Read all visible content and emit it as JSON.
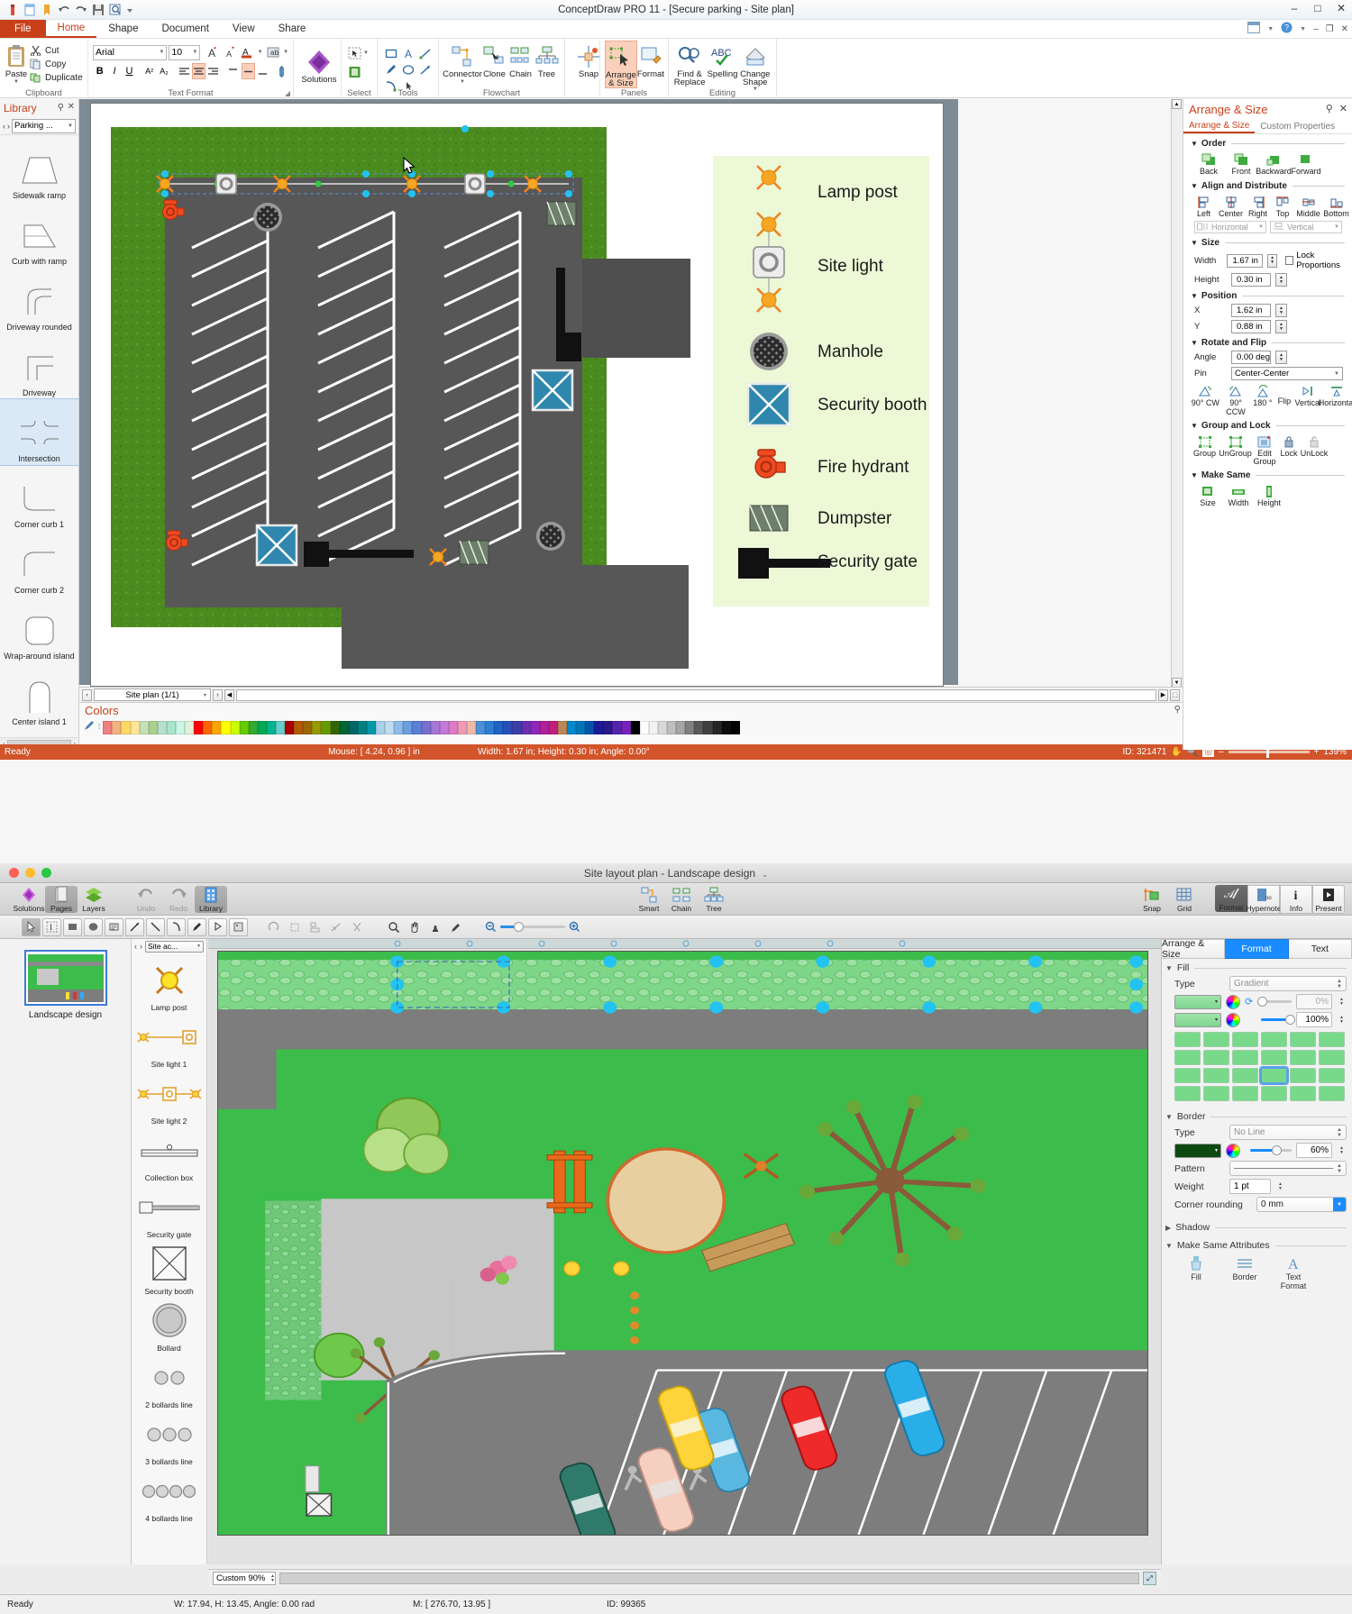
{
  "win1": {
    "title": "ConceptDraw PRO 11 - [Secure parking - Site plan]",
    "window_buttons": [
      "–",
      "□",
      "✕"
    ],
    "quick_access": [
      "new-icon",
      "open-icon",
      "doc-icon",
      "undo-icon",
      "redo-icon",
      "save-icon",
      "print-preview-icon",
      "qat-dropdown-icon"
    ],
    "tabs": [
      {
        "label": "File",
        "kind": "file"
      },
      {
        "label": "Home",
        "kind": "active"
      },
      {
        "label": "Shape",
        "kind": "normal"
      },
      {
        "label": "Document",
        "kind": "normal"
      },
      {
        "label": "View",
        "kind": "normal"
      },
      {
        "label": "Share",
        "kind": "normal"
      }
    ],
    "ribbon": {
      "clipboard": {
        "group": "Clipboard",
        "paste": "Paste",
        "cut": "Cut",
        "copy": "Copy",
        "duplicate": "Duplicate"
      },
      "text_format": {
        "group": "Text Format",
        "font_family": "Arial",
        "font_size": "10",
        "buttons": [
          "B",
          "I",
          "U",
          "A²",
          "A₂"
        ]
      },
      "solutions": {
        "group": "",
        "label": "Solutions"
      },
      "select": {
        "group": "Select"
      },
      "tools": {
        "group": "Tools"
      },
      "flowchart": {
        "group": "Flowchart",
        "connector": "Connector",
        "clone": "Clone",
        "chain": "Chain",
        "tree": "Tree",
        "snap": "Snap"
      },
      "panels": {
        "group": "Panels",
        "arrange": "Arrange\n& Size",
        "arrange_l1": "Arrange",
        "arrange_l2": "& Size",
        "format": "Format"
      },
      "editing": {
        "group": "Editing",
        "find": "Find &",
        "find2": "Replace",
        "spelling": "Spelling",
        "change": "Change",
        "change2": "Shape"
      }
    },
    "library": {
      "title": "Library",
      "selector": "Parking ...",
      "items": [
        {
          "label": "Sidewalk ramp",
          "icon": "sidewalk-ramp-shape"
        },
        {
          "label": "Curb with ramp",
          "icon": "curb-with-ramp-shape"
        },
        {
          "label": "Driveway rounded",
          "icon": "driveway-rounded-shape"
        },
        {
          "label": "Driveway",
          "icon": "driveway-shape"
        },
        {
          "label": "Intersection",
          "icon": "intersection-shape",
          "selected": true
        },
        {
          "label": "Corner curb 1",
          "icon": "corner-curb-1-shape"
        },
        {
          "label": "Corner curb 2",
          "icon": "corner-curb-2-shape"
        },
        {
          "label": "Wrap-around island",
          "icon": "wrap-around-island-shape"
        },
        {
          "label": "Center island 1",
          "icon": "center-island-1-shape"
        }
      ]
    },
    "legend": [
      {
        "label": "Lamp post",
        "icon": "lamp-post-icon"
      },
      {
        "label": "Site light",
        "icon": "site-light-icon"
      },
      {
        "label": "Manhole",
        "icon": "manhole-icon"
      },
      {
        "label": "Security booth",
        "icon": "security-booth-icon"
      },
      {
        "label": "Fire hydrant",
        "icon": "fire-hydrant-icon"
      },
      {
        "label": "Dumpster",
        "icon": "dumpster-icon"
      },
      {
        "label": "Security gate",
        "icon": "security-gate-icon"
      }
    ],
    "panel": {
      "title": "Arrange & Size",
      "tabs": [
        {
          "label": "Arrange & Size",
          "active": true
        },
        {
          "label": "Custom Properties",
          "active": false
        }
      ],
      "order": {
        "header": "Order",
        "items": [
          "Back",
          "Front",
          "Backward",
          "Forward"
        ]
      },
      "align": {
        "header": "Align and Distribute",
        "items": [
          "Left",
          "Center",
          "Right",
          "Top",
          "Middle",
          "Bottom"
        ],
        "horizontal": "Horizontal",
        "vertical": "Vertical"
      },
      "size": {
        "header": "Size",
        "width_label": "Width",
        "width": "1.67 in",
        "height_label": "Height",
        "height": "0.30 in",
        "lock": "Lock Proportions"
      },
      "position": {
        "header": "Position",
        "x_label": "X",
        "x": "1.62 in",
        "y_label": "Y",
        "y": "0.88 in"
      },
      "rotate": {
        "header": "Rotate and Flip",
        "angle_label": "Angle",
        "angle": "0.00 deg",
        "pin_label": "Pin",
        "pin": "Center-Center",
        "items": [
          "90° CW",
          "90° CCW",
          "180 °"
        ],
        "flip": "Flip",
        "vertical": "Vertical",
        "horizontal": "Horizontal"
      },
      "group": {
        "header": "Group and Lock",
        "items": [
          "Group",
          "UnGroup",
          "Edit Group",
          "Lock",
          "UnLock"
        ]
      },
      "makesame": {
        "header": "Make Same",
        "items": [
          "Size",
          "Width",
          "Height"
        ]
      }
    },
    "pagebar": {
      "tab": "Site plan (1/1)"
    },
    "colors": {
      "title": "Colors"
    },
    "status": {
      "ready": "Ready",
      "mouse": "Mouse: [ 4.24, 0.96 ] in",
      "dims": "Width: 1.67 in;  Height: 0.30 in;  Angle: 0.00°",
      "id": "ID: 321471",
      "zoom": "139%"
    }
  },
  "win2": {
    "title": "Site layout plan - Landscape design",
    "toolbar": {
      "left": [
        {
          "label": "Solutions",
          "icon": "solutions-icon"
        },
        {
          "label": "Pages",
          "icon": "pages-icon",
          "active": true
        },
        {
          "label": "Layers",
          "icon": "layers-icon"
        }
      ],
      "history": [
        {
          "label": "Undo",
          "icon": "undo-icon",
          "disabled": true
        },
        {
          "label": "Redo",
          "icon": "redo-icon",
          "disabled": true
        },
        {
          "label": "Library",
          "icon": "library-icon",
          "active": true
        }
      ],
      "center": [
        {
          "label": "Smart",
          "icon": "smart-connector-icon"
        },
        {
          "label": "Chain",
          "icon": "chain-icon"
        },
        {
          "label": "Tree",
          "icon": "tree-icon"
        }
      ],
      "snapgrid": [
        {
          "label": "Snap",
          "icon": "snap-icon"
        },
        {
          "label": "Grid",
          "icon": "grid-icon"
        }
      ],
      "right": [
        {
          "label": "Format",
          "icon": "format-icon",
          "active": true
        },
        {
          "label": "Hypernote",
          "icon": "hypernote-icon"
        },
        {
          "label": "Info",
          "icon": "info-icon"
        },
        {
          "label": "Present",
          "icon": "present-icon"
        }
      ]
    },
    "thumbnail": {
      "label": "Landscape design"
    },
    "library": {
      "selector": "Site ac...",
      "items": [
        {
          "label": "Lamp post",
          "icon": "lamp-post-icon"
        },
        {
          "label": "Site light 1",
          "icon": "site-light-1-icon"
        },
        {
          "label": "Site light 2",
          "icon": "site-light-2-icon"
        },
        {
          "label": "Collection box",
          "icon": "collection-box-icon"
        },
        {
          "label": "Security gate",
          "icon": "security-gate-icon"
        },
        {
          "label": "Security booth",
          "icon": "security-booth-icon"
        },
        {
          "label": "Bollard",
          "icon": "bollard-icon"
        },
        {
          "label": "2 bollards line",
          "icon": "2-bollards-line-icon"
        },
        {
          "label": "3 bollards line",
          "icon": "3-bollards-line-icon"
        },
        {
          "label": "4 bollards line",
          "icon": "4-bollards-line-icon"
        }
      ]
    },
    "panel": {
      "tabs": [
        {
          "label": "Arrange & Size",
          "active": false
        },
        {
          "label": "Format",
          "active": true
        },
        {
          "label": "Text",
          "active": false
        }
      ],
      "fill": {
        "header": "Fill",
        "type_label": "Type",
        "type": "Gradient",
        "stop1_pct": "0%",
        "stop2_pct": "100%",
        "color1": "#8fdd9b",
        "color2": "#8fdd9b",
        "swatch_rows": 4,
        "swatch_cols": 6,
        "selected_index": 15
      },
      "border": {
        "header": "Border",
        "type_label": "Type",
        "type": "No Line",
        "color": "#0d4a12",
        "opacity": "60%",
        "pattern_label": "Pattern",
        "weight_label": "Weight",
        "weight": "1 pt",
        "corner_label": "Corner rounding",
        "corner": "0 mm"
      },
      "shadow": {
        "header": "Shadow"
      },
      "makesame": {
        "header": "Make Same Attributes",
        "items": [
          "Fill",
          "Border",
          "Text Format"
        ]
      }
    },
    "bottombar": {
      "zoom": "Custom 90%"
    },
    "status": {
      "ready": "Ready",
      "dims": "W: 17.94,  H: 13.45,  Angle: 0.00 rad",
      "mouse": "M: [ 276.70, 13.95 ]",
      "id": "ID: 99365"
    }
  },
  "palette": {
    "accent_red": "#c8401a",
    "status_bar": "#d1542a",
    "mac_blue": "#1a8cff",
    "grass": "#4a8a1f",
    "asphalt": "#575757",
    "legend_bg": "#ecf8d6",
    "booth_blue": "#2f87ad",
    "lamp_orange": "#f5a623",
    "hydrant_red": "#e8491f",
    "w2_grass": "#3cbc4a",
    "w2_road": "#7d7d7d"
  },
  "color_swatches": [
    "#f08080",
    "#f4b183",
    "#ffd966",
    "#ffe699",
    "#c6e0b4",
    "#a9d08e",
    "#b7e1cd",
    "#a8e6cf",
    "#c9f7e5",
    "#e2f0d9",
    "#ff0000",
    "#ff6600",
    "#ffa500",
    "#ffff00",
    "#ccff00",
    "#66cc00",
    "#33aa33",
    "#00aa55",
    "#00b38f",
    "#66cccc",
    "#aa0000",
    "#b35900",
    "#996600",
    "#999900",
    "#669900",
    "#336600",
    "#006633",
    "#006666",
    "#008080",
    "#0099aa",
    "#a8d0e8",
    "#c0dcf0",
    "#8fbbe8",
    "#6a9fe0",
    "#5b7fd4",
    "#7a6fd0",
    "#a678d6",
    "#c27ad8",
    "#e07ac4",
    "#f09ab8",
    "#f0b8a8",
    "#4a90d9",
    "#2e7fd4",
    "#1f63c4",
    "#2a4fb8",
    "#3a3fa8",
    "#6a2fb0",
    "#8f28b8",
    "#b0209c",
    "#c01f7a",
    "#bb8855",
    "#0088cc",
    "#0077bb",
    "#0055aa",
    "#1a1a99",
    "#2a1a88",
    "#5522aa",
    "#7722bb",
    "#000000",
    "#ffffff",
    "#f2f2f2",
    "#d9d9d9",
    "#bfbfbf",
    "#a6a6a6",
    "#808080",
    "#595959",
    "#404040",
    "#262626",
    "#0d0d0d",
    "#000000"
  ]
}
